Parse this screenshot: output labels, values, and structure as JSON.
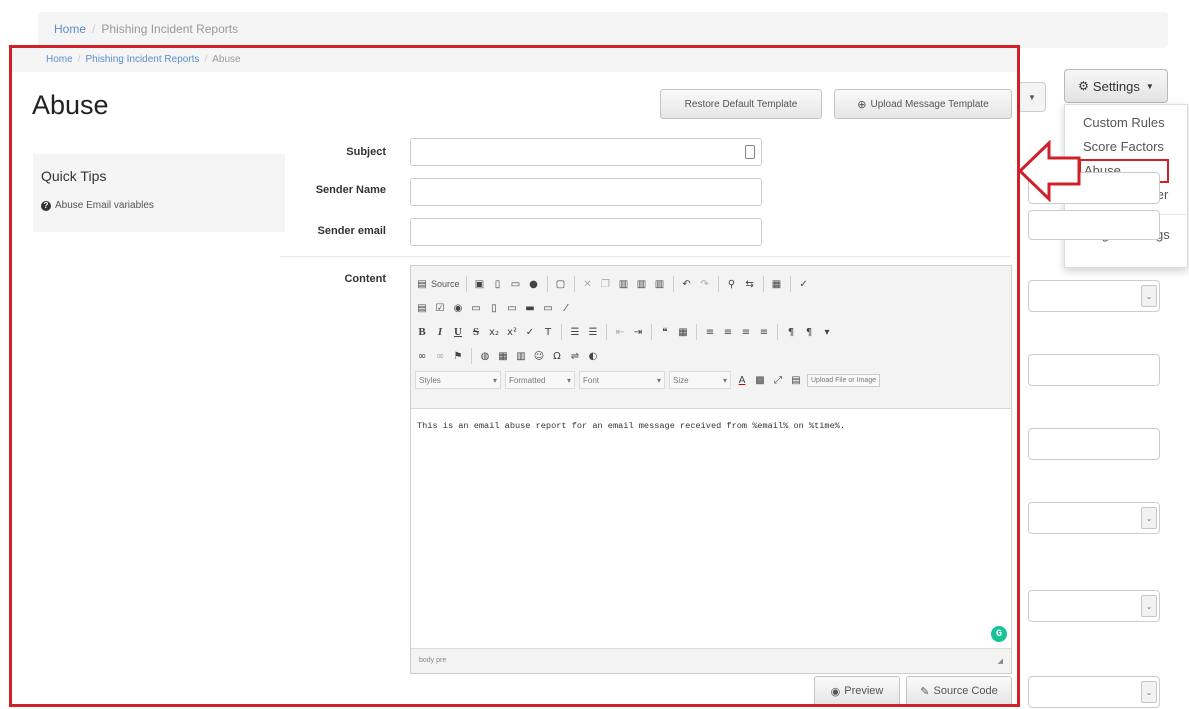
{
  "background": {
    "breadcrumb": {
      "home": "Home",
      "separator": "/",
      "current": "Phishing Incident Reports"
    },
    "settings_button": {
      "icon": "gear-icon",
      "label": "Settings"
    },
    "settings_menu": {
      "items": [
        "Custom Rules",
        "Score Factors",
        "Abuse",
        "Autoresponder",
        "Plugin Settings"
      ],
      "active_item": "Abuse"
    }
  },
  "annotation": {
    "color": "#d0202a",
    "arrow_points_to": "Abuse"
  },
  "panel": {
    "breadcrumb": {
      "home": "Home",
      "separator": "/",
      "parent": "Phishing Incident Reports",
      "current": "Abuse"
    },
    "title": "Abuse",
    "buttons": {
      "restore": "Restore Default Template",
      "upload": "Upload Message Template",
      "preview": "Preview",
      "source_code": "Source Code"
    },
    "quick_tips": {
      "title": "Quick Tips",
      "item": "Abuse Email variables"
    },
    "form": {
      "subject_label": "Subject",
      "sender_name_label": "Sender Name",
      "sender_email_label": "Sender email",
      "content_label": "Content",
      "subject_value": "",
      "sender_name_value": "",
      "sender_email_value": ""
    },
    "editor": {
      "source_label": "Source",
      "styles_combo": "Styles",
      "format_combo": "Formatted",
      "font_combo": "Font",
      "size_combo": "Size",
      "upload_image": "Upload File or Image",
      "body_text": "This is an email abuse report for an email message received from %email% on %time%.",
      "status_path": "body  pre"
    }
  }
}
